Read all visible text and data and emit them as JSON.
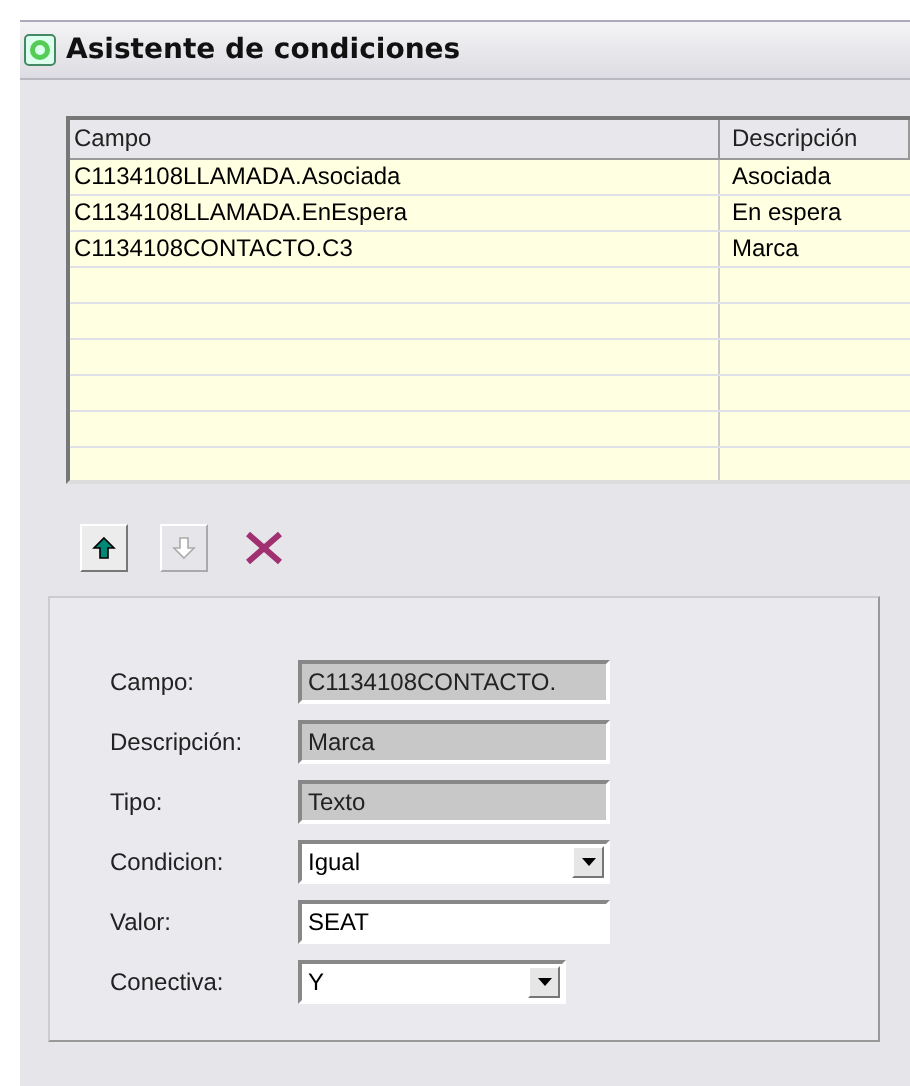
{
  "window": {
    "title": "Asistente de condiciones"
  },
  "table": {
    "columns": [
      "Campo",
      "Descripción"
    ],
    "rows": [
      {
        "cells": [
          "C1134108LLAMADA.Asociada",
          "Asociada"
        ]
      },
      {
        "cells": [
          "C1134108LLAMADA.EnEspera",
          "En espera"
        ]
      },
      {
        "cells": [
          "C1134108CONTACTO.C3",
          "Marca"
        ]
      }
    ]
  },
  "toolbar": [
    {
      "kind": "up",
      "disabled": false
    },
    {
      "kind": "down",
      "disabled": true
    },
    {
      "kind": "delete",
      "disabled": false
    }
  ],
  "form": [
    {
      "label": "Campo:",
      "kind": "readonly",
      "value": "C1134108CONTACTO."
    },
    {
      "label": "Descripción:",
      "kind": "readonly",
      "value": "Marca"
    },
    {
      "label": "Tipo:",
      "kind": "readonly",
      "value": "Texto"
    },
    {
      "label": "Condicion:",
      "kind": "dropdown",
      "value": "Igual"
    },
    {
      "label": "Valor:",
      "kind": "text",
      "value": "SEAT"
    },
    {
      "label": "Conectiva:",
      "kind": "dropdown-short",
      "value": "Y"
    }
  ]
}
